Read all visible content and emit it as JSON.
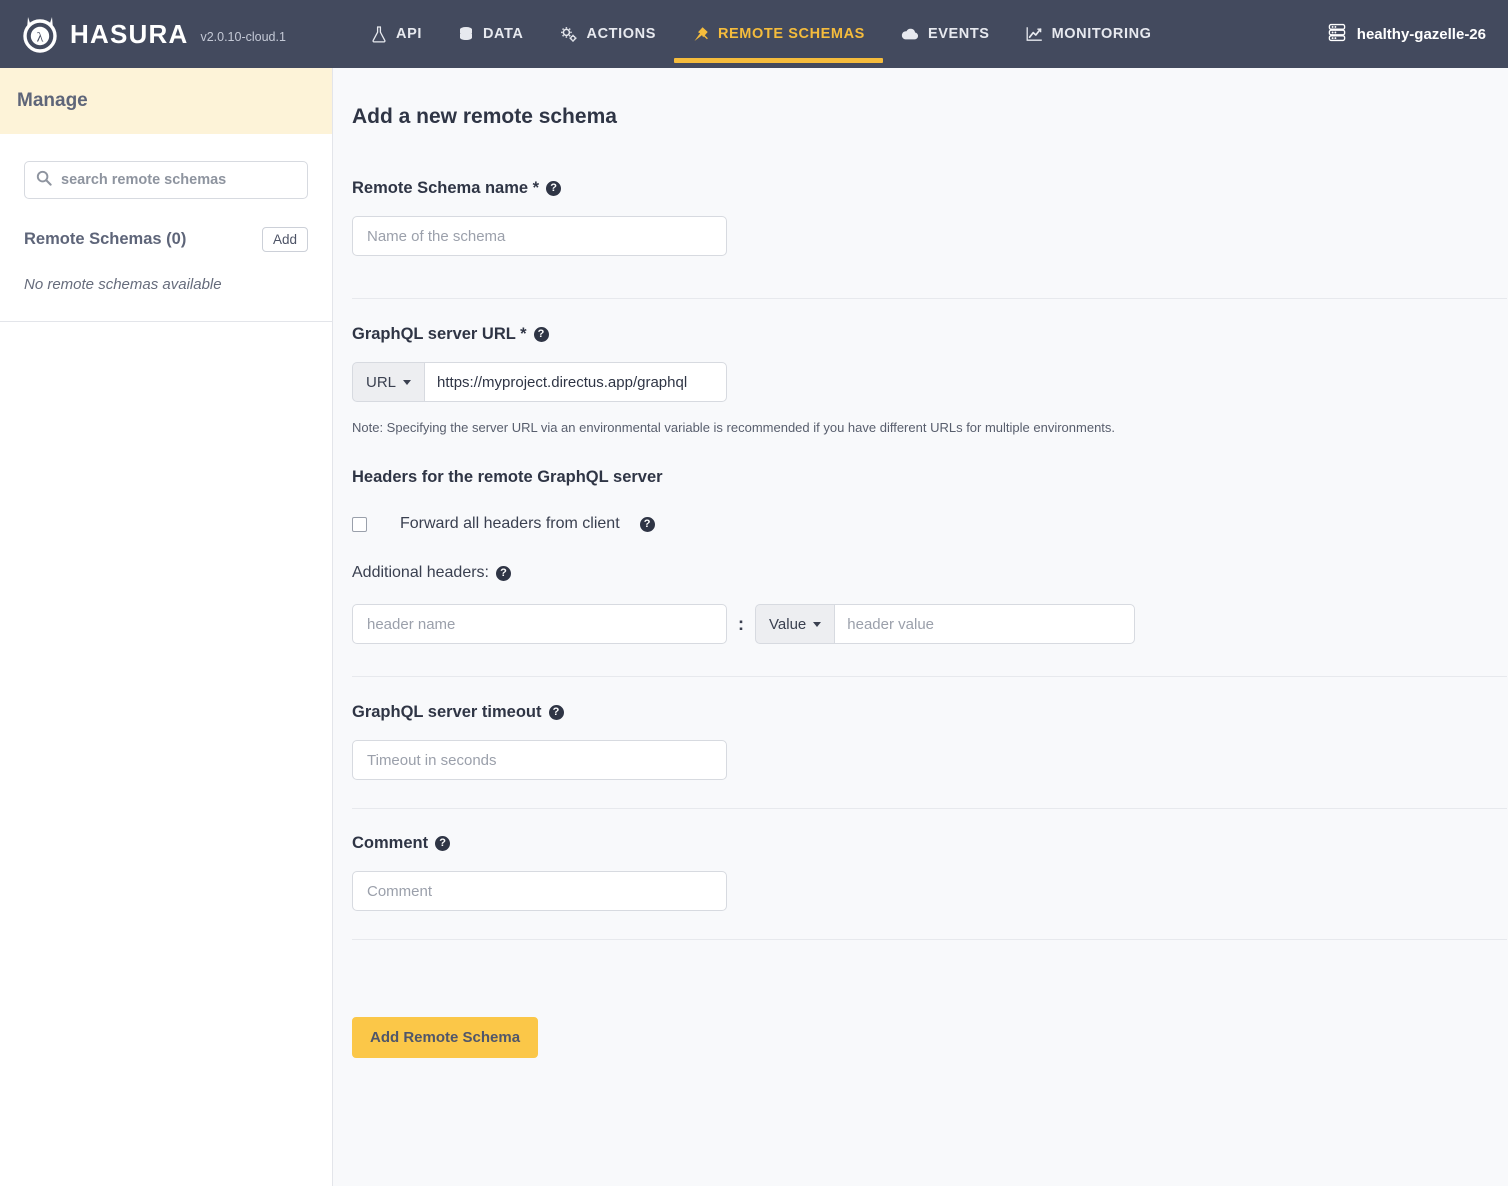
{
  "brand": {
    "name": "HASURA",
    "version": "v2.0.10-cloud.1",
    "logo_icon": "hasura-mascot-logo"
  },
  "nav": {
    "items": [
      {
        "label": "API",
        "icon": "flask-icon",
        "active": false
      },
      {
        "label": "DATA",
        "icon": "database-icon",
        "active": false
      },
      {
        "label": "ACTIONS",
        "icon": "gears-icon",
        "active": false
      },
      {
        "label": "REMOTE SCHEMAS",
        "icon": "plug-icon",
        "active": true
      },
      {
        "label": "EVENTS",
        "icon": "cloud-icon",
        "active": false
      },
      {
        "label": "MONITORING",
        "icon": "chart-line-icon",
        "active": false
      }
    ],
    "active_color": "#f5bc3c",
    "bar_color": "#434a5e"
  },
  "project": {
    "name": "healthy-gazelle-26",
    "icon": "server-rack-icon"
  },
  "sidebar": {
    "header": "Manage",
    "header_bg": "#fdf3d8",
    "search": {
      "placeholder": "search remote schemas",
      "icon": "search-icon"
    },
    "list_title": "Remote Schemas (0)",
    "add_label": "Add",
    "empty_message": "No remote schemas available"
  },
  "main": {
    "page_title": "Add a new remote schema",
    "schema_name": {
      "label": "Remote Schema name *",
      "help_icon": "question-circle-icon",
      "placeholder": "Name of the schema",
      "value": ""
    },
    "server_url": {
      "label": "GraphQL server URL *",
      "help_icon": "question-circle-icon",
      "type_label": "URL",
      "type_caret": "chevron-down-icon",
      "value": "https://myproject.directus.app/graphql",
      "placeholder": "",
      "note": "Note: Specifying the server URL via an environmental variable is recommended if you have different URLs for multiple environments."
    },
    "headers": {
      "section_label": "Headers for the remote GraphQL server",
      "forward_all_label": "Forward all headers from client",
      "forward_all_checked": false,
      "additional_label": "Additional headers:",
      "help_icon": "question-circle-icon",
      "name_placeholder": "header name",
      "name_value": "",
      "separator": ":",
      "value_type_label": "Value",
      "value_placeholder": "header value",
      "value_value": ""
    },
    "timeout": {
      "label": "GraphQL server timeout",
      "help_icon": "question-circle-icon",
      "placeholder": "Timeout in seconds",
      "value": ""
    },
    "comment": {
      "label": "Comment",
      "help_icon": "question-circle-icon",
      "placeholder": "Comment",
      "value": ""
    },
    "submit_label": "Add Remote Schema",
    "submit_color": "#fbc748"
  }
}
